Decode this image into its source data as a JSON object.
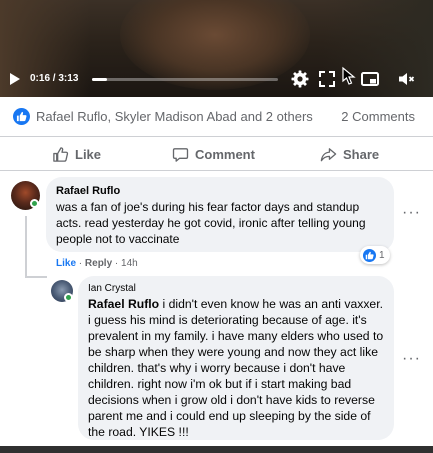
{
  "video": {
    "current_time": "0:16",
    "duration": "3:13",
    "progress": 0.083
  },
  "reactions": {
    "names": "Rafael Ruflo, Skyler Madison Abad and 2 others",
    "comment_count": "2 Comments"
  },
  "actions": {
    "like": "Like",
    "comment": "Comment",
    "share": "Share"
  },
  "comments": [
    {
      "author": "Rafael Ruflo",
      "text": "was a fan of joe's during his fear factor days and standup acts. read yesterday he got covid, ironic after telling young people not to vaccinate",
      "like_label": "Like",
      "reply_label": "Reply",
      "age": "14h",
      "reaction_count": "1",
      "more": "···"
    },
    {
      "author": "Ian Crystal",
      "mention": "Rafael Ruflo",
      "text": " i didn't even know he was an anti vaxxer. i guess his mind is deteriorating because of age. it's prevalent in my family. i have many elders who used to be sharp when they were young and now they act like children. that's why i worry because i don't have children. right now i'm ok but if i start making bad decisions when i grow old i don't have kids to reverse parent me and i could end up sleeping by the side of the road. YIKES !!!",
      "more": "···"
    }
  ],
  "colors": {
    "accent": "#1877f2",
    "bubble": "#f0f2f5",
    "muted": "#65676b",
    "online": "#31a24c"
  }
}
